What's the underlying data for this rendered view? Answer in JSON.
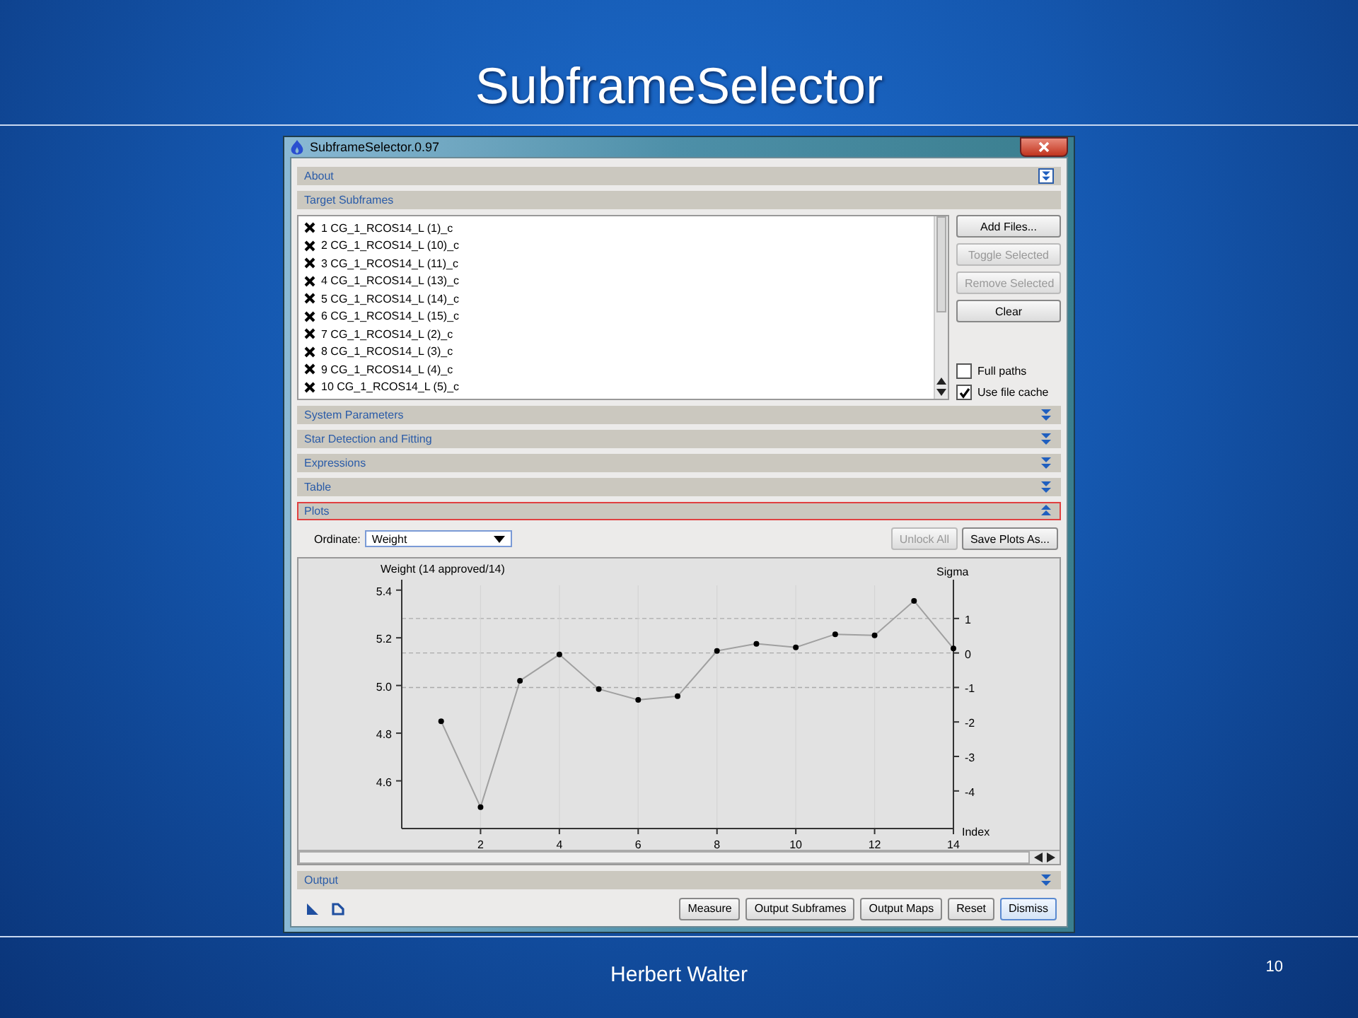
{
  "slide": {
    "title": "SubframeSelector",
    "author": "Herbert Walter",
    "page": "10"
  },
  "window": {
    "title": "SubframeSelector.0.97"
  },
  "panels": [
    {
      "kind": "plain",
      "title": "About",
      "expanded": false,
      "focused": true
    },
    {
      "kind": "files",
      "title": "Target Subframes"
    },
    {
      "kind": "plain",
      "title": "System Parameters",
      "expanded": false
    },
    {
      "kind": "plain",
      "title": "Star Detection and Fitting",
      "expanded": false
    },
    {
      "kind": "plain",
      "title": "Expressions",
      "expanded": false
    },
    {
      "kind": "plain",
      "title": "Table",
      "expanded": false
    },
    {
      "kind": "plots",
      "title": "Plots",
      "expanded": true,
      "highlighted": true
    },
    {
      "kind": "plain",
      "title": "Output",
      "expanded": false
    }
  ],
  "files": [
    {
      "name": "1 CG_1_RCOS14_L (1)_c",
      "excluded": true
    },
    {
      "name": "2 CG_1_RCOS14_L (10)_c",
      "excluded": true
    },
    {
      "name": "3 CG_1_RCOS14_L (11)_c",
      "excluded": true
    },
    {
      "name": "4 CG_1_RCOS14_L (13)_c",
      "excluded": true
    },
    {
      "name": "5 CG_1_RCOS14_L (14)_c",
      "excluded": true
    },
    {
      "name": "6 CG_1_RCOS14_L (15)_c",
      "excluded": true
    },
    {
      "name": "7 CG_1_RCOS14_L (2)_c",
      "excluded": true
    },
    {
      "name": "8 CG_1_RCOS14_L (3)_c",
      "excluded": true
    },
    {
      "name": "9 CG_1_RCOS14_L (4)_c",
      "excluded": true
    },
    {
      "name": "10 CG_1_RCOS14_L (5)_c",
      "excluded": true
    }
  ],
  "file_buttons": [
    {
      "label": "Add Files...",
      "disabled": false
    },
    {
      "label": "Toggle Selected",
      "disabled": true
    },
    {
      "label": "Remove Selected",
      "disabled": true
    },
    {
      "label": "Clear",
      "disabled": false
    }
  ],
  "file_options": [
    {
      "label": "Full paths",
      "checked": false
    },
    {
      "label": "Use file cache",
      "checked": true
    }
  ],
  "plots": {
    "ordinate_label": "Ordinate:",
    "ordinate_value": "Weight",
    "buttons": [
      {
        "label": "Unlock All",
        "disabled": true
      },
      {
        "label": "Save Plots As...",
        "disabled": false
      }
    ],
    "chart_data": {
      "type": "line",
      "title": "Weight (14 approved/14)",
      "xlabel": "Index",
      "x": [
        1,
        2,
        3,
        4,
        5,
        6,
        7,
        8,
        9,
        10,
        11,
        12,
        13,
        14
      ],
      "series": [
        {
          "color": "#a0a0a0",
          "marker": "circle",
          "values": [
            4.85,
            4.49,
            5.02,
            5.13,
            4.985,
            4.94,
            4.955,
            5.145,
            5.175,
            5.16,
            5.215,
            5.21,
            5.355,
            5.155
          ]
        }
      ],
      "xlim": [
        0,
        14
      ],
      "ylim": [
        4.4,
        5.42
      ],
      "xticks": [
        2,
        4,
        6,
        8,
        10,
        12,
        14
      ],
      "yticks": [
        {
          "value": 4.6,
          "label": "4.6"
        },
        {
          "value": 4.8,
          "label": "4.8"
        },
        {
          "value": 5,
          "label": "5.0"
        },
        {
          "value": 5.2,
          "label": "5.2"
        },
        {
          "value": 5.4,
          "label": "5.4"
        }
      ],
      "grid": true,
      "y2label": "Sigma",
      "y2lim": [
        -5.09,
        1.96
      ],
      "y2ticks": [
        1,
        0,
        -1,
        -2,
        -3,
        -4
      ]
    }
  },
  "bottom_buttons": [
    {
      "label": "Measure",
      "default": false
    },
    {
      "label": "Output Subframes",
      "default": false
    },
    {
      "label": "Output Maps",
      "default": false
    },
    {
      "label": "Reset",
      "default": false
    },
    {
      "label": "Dismiss",
      "default": true
    }
  ]
}
